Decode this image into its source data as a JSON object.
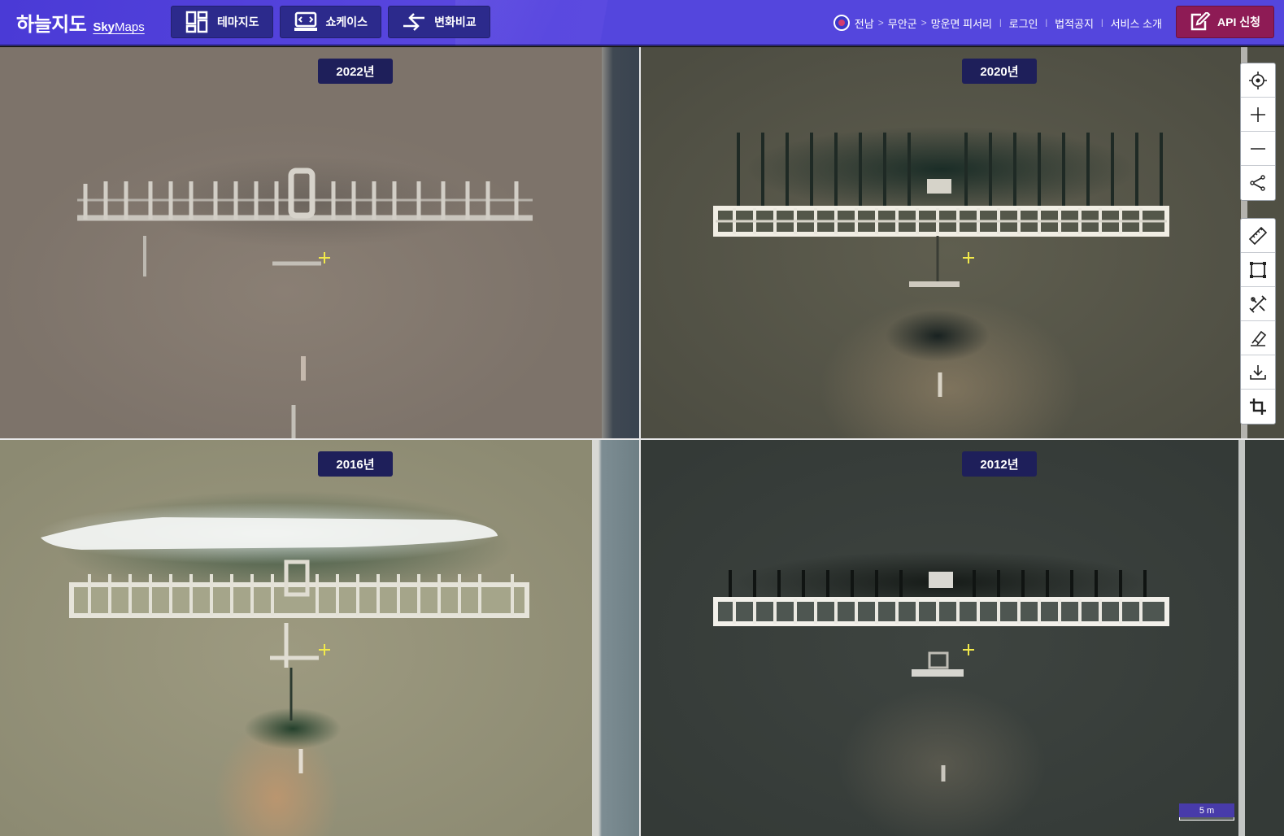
{
  "header": {
    "logo_ko": "하늘지도",
    "logo_en_bold": "Sky",
    "logo_en_rest": "Maps",
    "nav": [
      {
        "label": "테마지도",
        "icon": "theme-map-icon"
      },
      {
        "label": "쇼케이스",
        "icon": "showcase-icon"
      },
      {
        "label": "변화비교",
        "icon": "compare-icon"
      }
    ],
    "location": [
      "전남",
      "무안군",
      "망운면 피서리"
    ],
    "location_sep": ">",
    "links": [
      "로그인",
      "법적공지",
      "서비스 소개"
    ],
    "link_sep": "|",
    "api_button": "API 신청"
  },
  "panes": [
    {
      "year": "2022년"
    },
    {
      "year": "2020년"
    },
    {
      "year": "2016년"
    },
    {
      "year": "2012년"
    }
  ],
  "toolbar": {
    "group1": [
      "current-location-icon",
      "zoom-in-icon",
      "zoom-out-icon",
      "share-icon"
    ],
    "group2": [
      "ruler-icon",
      "area-measure-icon",
      "tools-icon",
      "eraser-icon",
      "download-icon",
      "crop-icon"
    ]
  },
  "scale": {
    "label": "5 m"
  },
  "colors": {
    "header": "#5446dd",
    "nav_button": "#2c2a8c",
    "api_button": "#8e1b55",
    "year_badge": "#1e1f5a",
    "crosshair": "#f1e94a"
  }
}
